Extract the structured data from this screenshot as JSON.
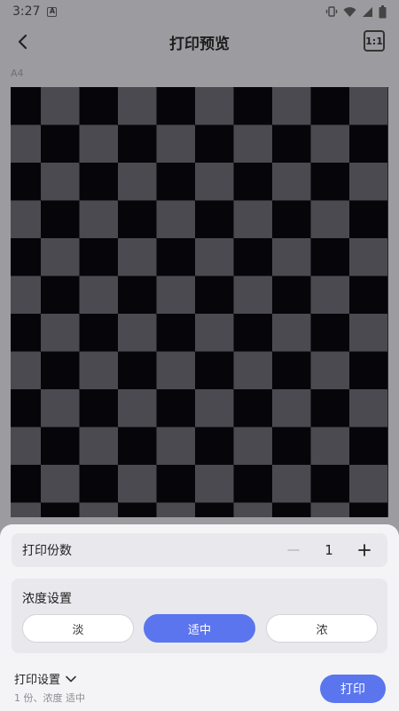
{
  "status_bar": {
    "time": "3:27",
    "notif_glyph": "A",
    "icons": [
      "vibrate-icon",
      "wifi-icon",
      "signal-icon",
      "battery-icon"
    ]
  },
  "app_bar": {
    "title": "打印预览",
    "ratio_label": "1:1",
    "back_icon": "back-arrow-icon"
  },
  "paper_label": "A4",
  "copies": {
    "label": "打印份数",
    "value": "1",
    "minus_icon": "minus-icon",
    "plus_icon": "plus-icon"
  },
  "density": {
    "title": "浓度设置",
    "options": [
      "淡",
      "适中",
      "浓"
    ],
    "selected": "适中"
  },
  "footer": {
    "settings_label": "打印设置",
    "summary": "1 份、浓度 适中",
    "print_label": "打印"
  },
  "colors": {
    "accent": "#5b75ee",
    "panel": "#e9e9ed",
    "sheet": "#f4f4f6"
  }
}
